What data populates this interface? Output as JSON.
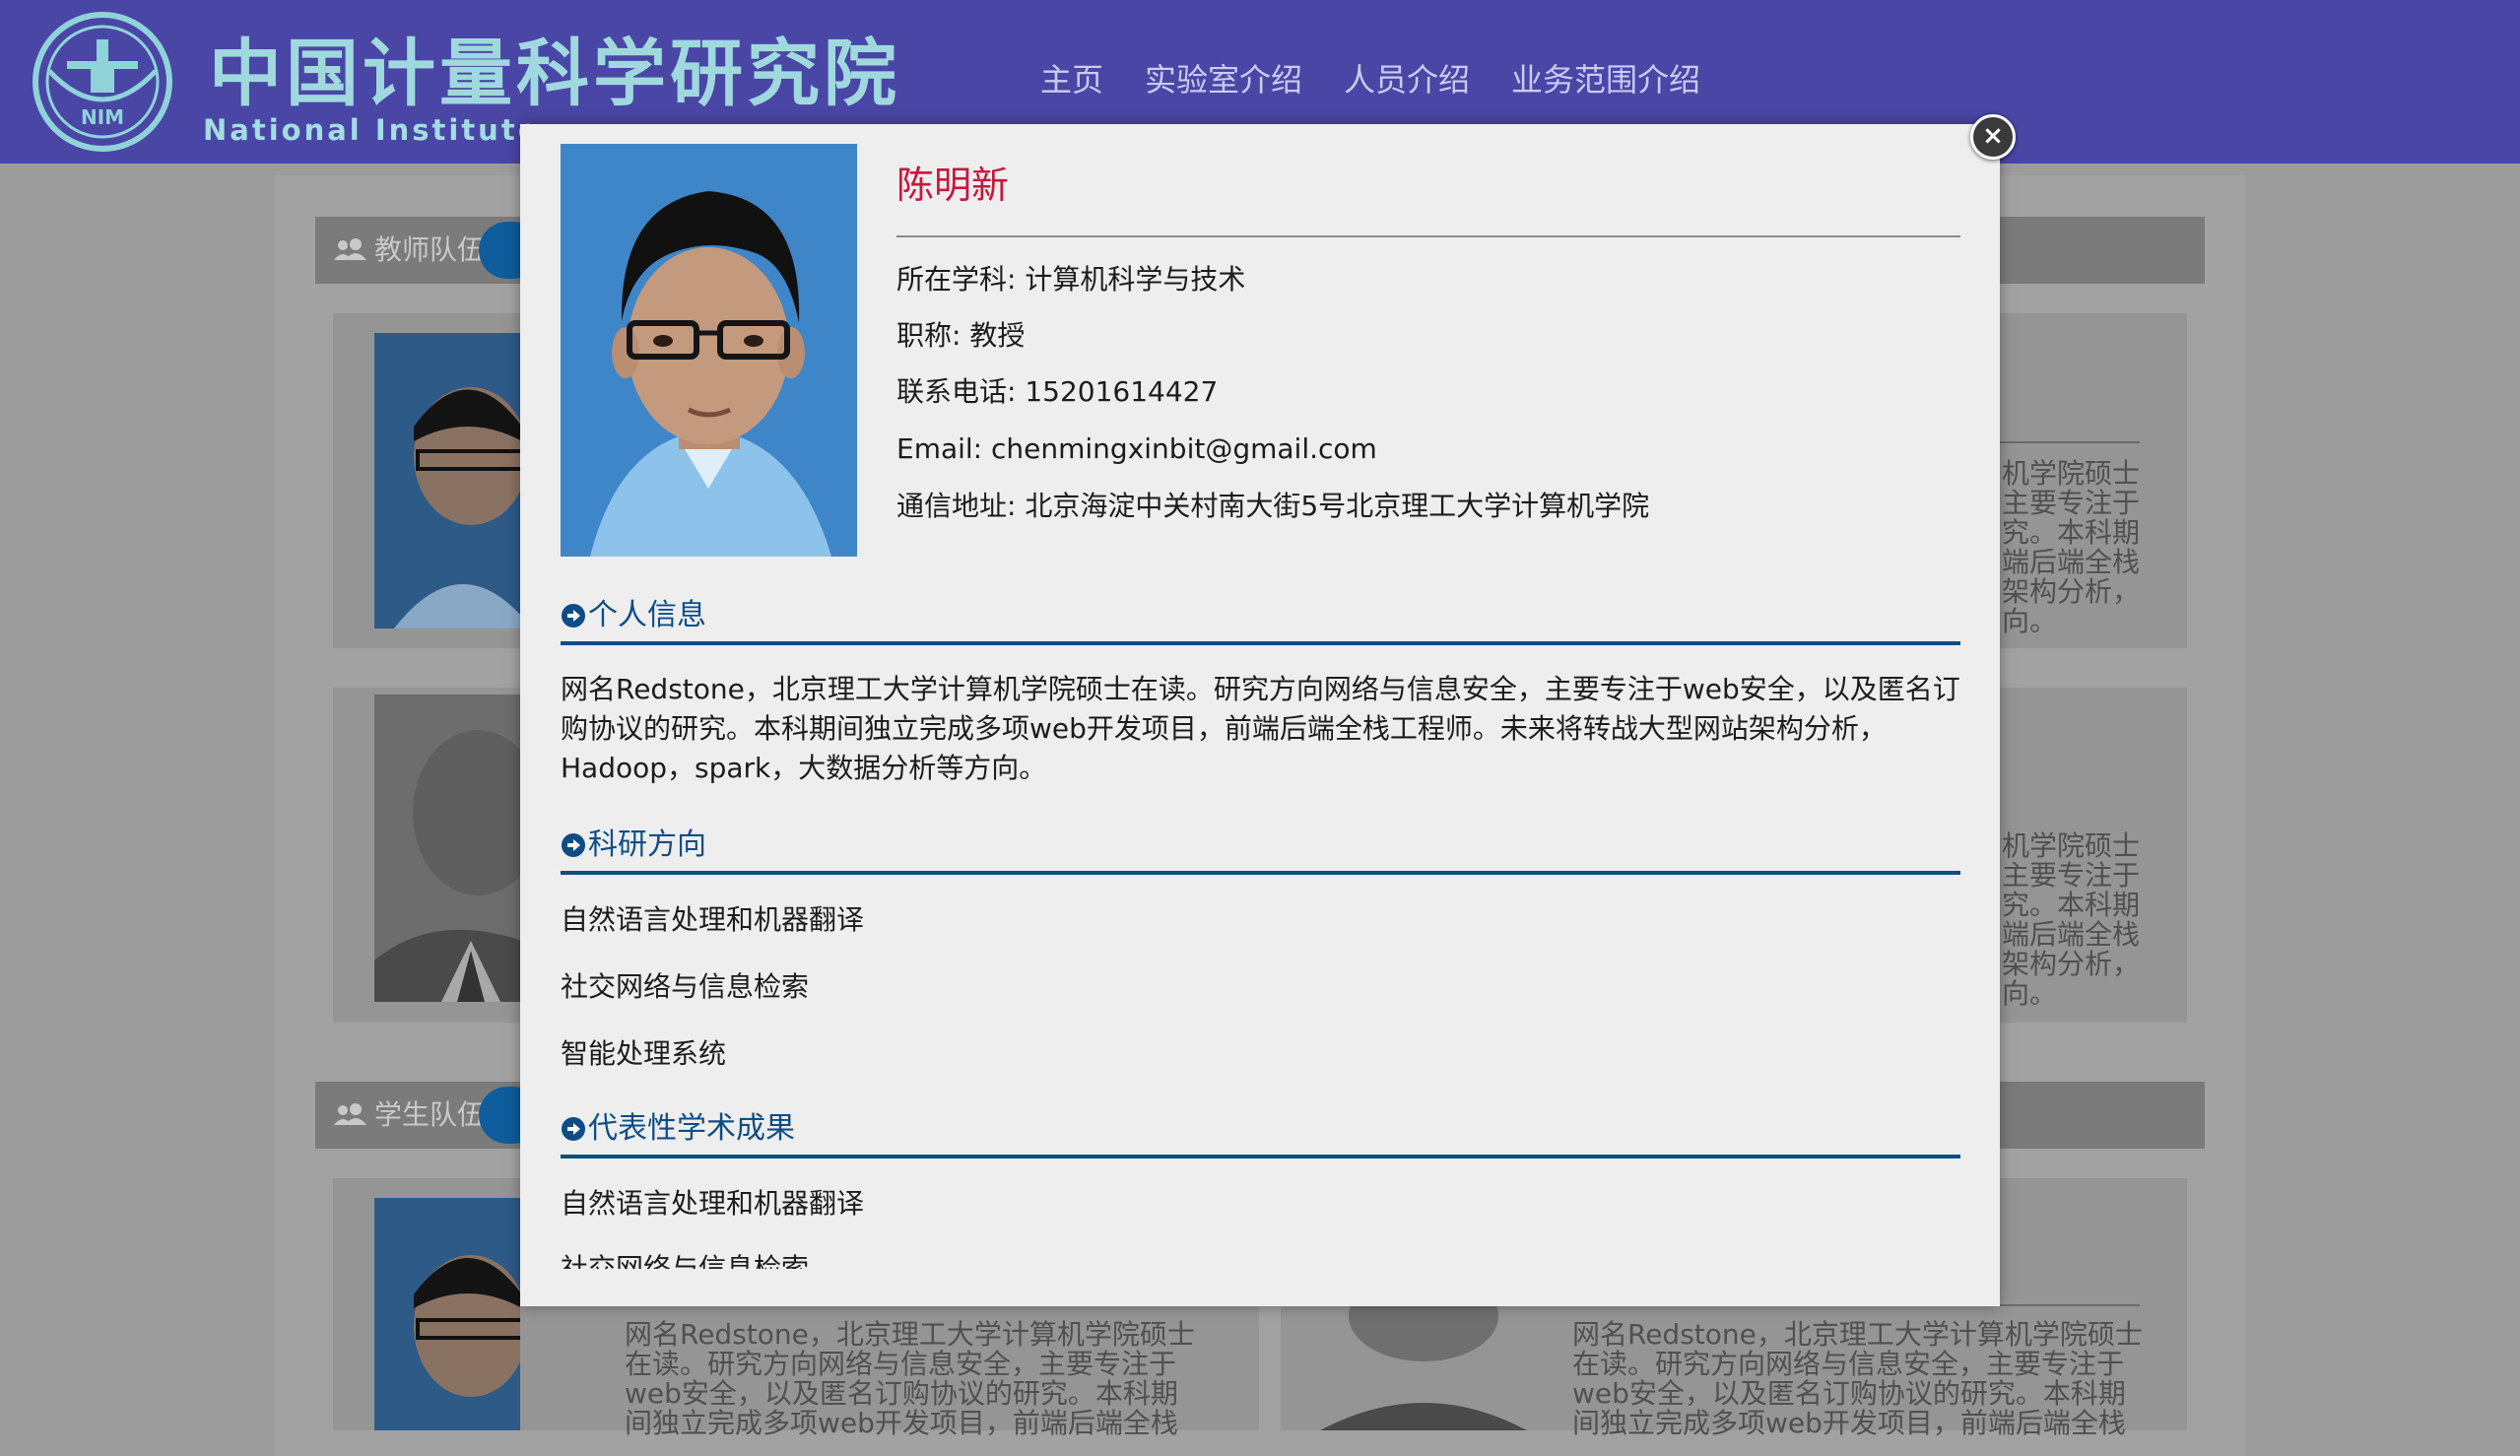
{
  "header": {
    "title": "中国计量科学研究院",
    "subtitle": "National Institute",
    "logo_text": "NIM",
    "nav": [
      "主页",
      "实验室介绍",
      "人员介绍",
      "业务范围介绍"
    ]
  },
  "page": {
    "teachers_section": "教师队伍",
    "students_section": "学生队伍",
    "bg_right_fragments_1": [
      "机学院硕士",
      "主要专注于",
      "究。本科期",
      "端后端全栈",
      "架构分析，",
      "向。"
    ],
    "bg_right_fragments_2": [
      "机学院硕士",
      "主要专注于",
      "究。本科期",
      "端后端全栈",
      "架构分析，",
      "向。"
    ],
    "bg_bottom_text_left": [
      "网名Redstone，北京理工大学计算机学院硕士",
      "在读。研究方向网络与信息安全，主要专注于",
      "web安全，以及匿名订购协议的研究。本科期",
      "间独立完成多项web开发项目，前端后端全栈"
    ],
    "bg_bottom_text_right": [
      "网名Redstone，北京理工大学计算机学院硕士",
      "在读。研究方向网络与信息安全，主要专注于",
      "web安全，以及匿名订购协议的研究。本科期",
      "间独立完成多项web开发项目，前端后端全栈"
    ]
  },
  "modal": {
    "close_symbol": "×",
    "name": "陈明新",
    "info": {
      "discipline": "所在学科: 计算机科学与技术",
      "title": "职称: 教授",
      "phone": "联系电话: 15201614427",
      "email": "Email: chenmingxinbit@gmail.com",
      "address": "通信地址: 北京海淀中关村南大街5号北京理工大学计算机学院"
    },
    "personal_info_heading": "个人信息",
    "bio": "网名Redstone，北京理工大学计算机学院硕士在读。研究方向网络与信息安全，主要专注于web安全，以及匿名订购协议的研究。本科期间独立完成多项web开发项目，前端后端全栈工程师。未来将转战大型网站架构分析，Hadoop，spark，大数据分析等方向。",
    "research_heading": "科研方向",
    "research_items": [
      "自然语言处理和机器翻译",
      "社交网络与信息检索",
      "智能处理系统"
    ],
    "achievements_heading": "代表性学术成果",
    "achievement_items": [
      "自然语言处理和机器翻译",
      "社交网络与信息检索"
    ]
  },
  "colors": {
    "header_bg": "#4a46a6",
    "name_color": "#c8173d",
    "section_blue": "#0d4d86",
    "overlay_gray": "#9c9c9c"
  },
  "icons": [
    "nim-logo-icon",
    "users-icon",
    "arrow-circle-right-icon",
    "close-icon"
  ]
}
